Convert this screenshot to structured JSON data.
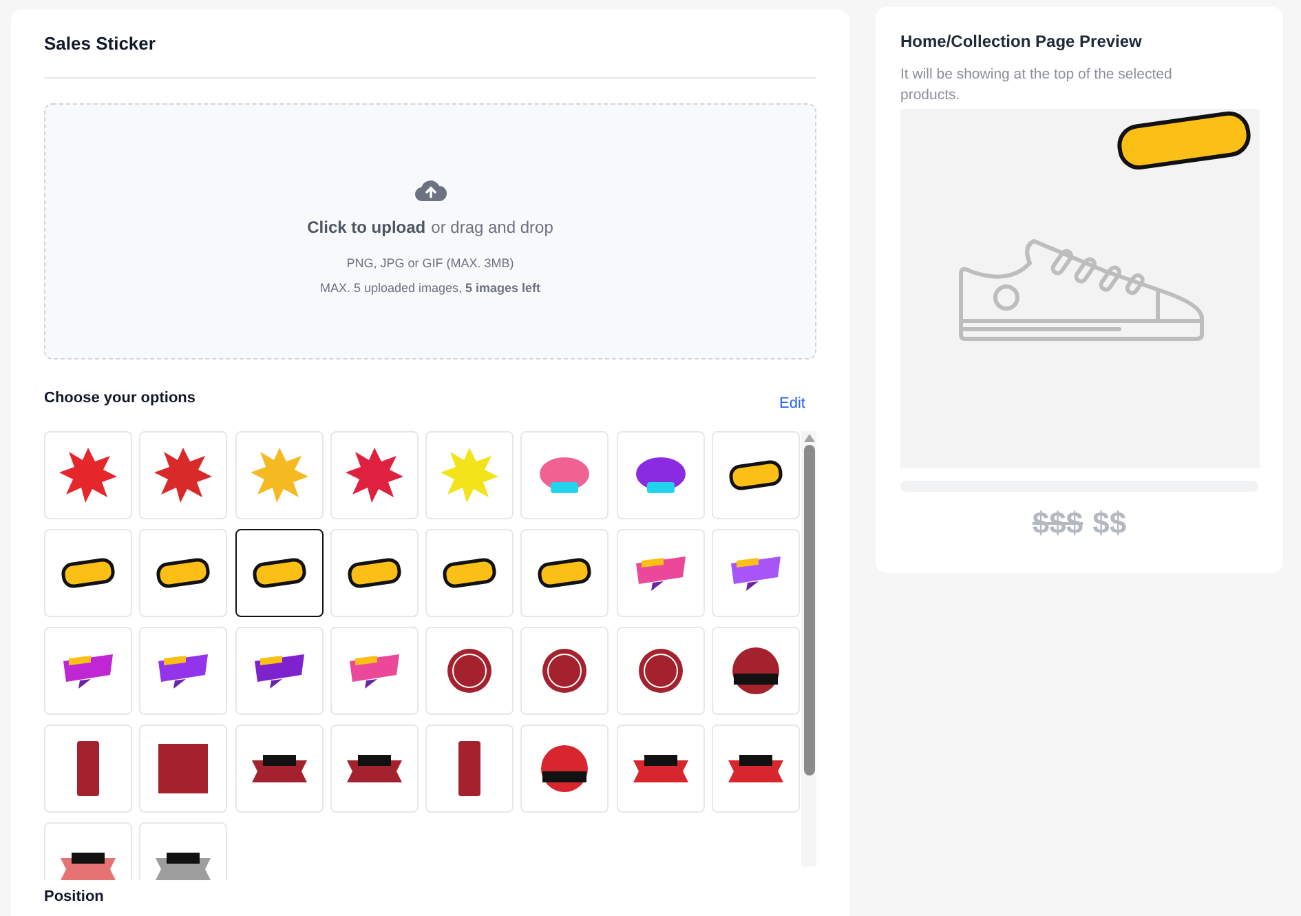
{
  "sticker_panel": {
    "title": "Sales Sticker",
    "upload": {
      "action": "Click to upload",
      "rest": "or drag and drop",
      "formats": "PNG, JPG or GIF (MAX. 3MB)",
      "limit": "MAX. 5 uploaded images, **5 images left**"
    },
    "options_title": "Choose your options",
    "edit_link": "Edit",
    "stickers": [
      {
        "kind": "burst",
        "color": "#e5262b",
        "selected": false
      },
      {
        "kind": "burst",
        "color": "#d92a2a",
        "selected": false
      },
      {
        "kind": "burst",
        "color": "#f5b921",
        "selected": false
      },
      {
        "kind": "burst",
        "color": "#e0203f",
        "selected": false
      },
      {
        "kind": "burst",
        "color": "#f2e31b",
        "selected": false
      },
      {
        "kind": "cloud",
        "color": "#f06292",
        "selected": false
      },
      {
        "kind": "cloud",
        "color": "#8a2be2",
        "selected": false
      },
      {
        "kind": "tag",
        "color": "#fbbf16",
        "selected": false
      },
      {
        "kind": "tag",
        "color": "#fbbf16",
        "selected": false
      },
      {
        "kind": "tag",
        "color": "#fbbf16",
        "selected": false
      },
      {
        "kind": "tag",
        "color": "#fbbf16",
        "selected": true
      },
      {
        "kind": "tag",
        "color": "#fbbf16",
        "selected": false
      },
      {
        "kind": "tag",
        "color": "#fbbf16",
        "selected": false
      },
      {
        "kind": "tag",
        "color": "#fbbf16",
        "selected": false
      },
      {
        "kind": "ribbon",
        "color": "#ec4899",
        "selected": false
      },
      {
        "kind": "ribbon",
        "color": "#a855f7",
        "selected": false
      },
      {
        "kind": "ribbon",
        "color": "#c026d3",
        "selected": false
      },
      {
        "kind": "ribbon",
        "color": "#9333ea",
        "selected": false
      },
      {
        "kind": "ribbon",
        "color": "#7e22ce",
        "selected": false
      },
      {
        "kind": "ribbon",
        "color": "#ec4899",
        "selected": false
      },
      {
        "kind": "seal",
        "color": "#a3222e",
        "selected": false
      },
      {
        "kind": "seal",
        "color": "#a3222e",
        "selected": false
      },
      {
        "kind": "seal",
        "color": "#a3222e",
        "selected": false
      },
      {
        "kind": "circle",
        "color": "#a3222e",
        "selected": false
      },
      {
        "kind": "vertical",
        "color": "#a3222e",
        "selected": false
      },
      {
        "kind": "square",
        "color": "#a3222e",
        "selected": false
      },
      {
        "kind": "banner",
        "color": "#a3222e",
        "selected": false
      },
      {
        "kind": "banner",
        "color": "#a3222e",
        "selected": false
      },
      {
        "kind": "vertical",
        "color": "#a3222e",
        "selected": false
      },
      {
        "kind": "circle",
        "color": "#d7262e",
        "selected": false
      },
      {
        "kind": "banner",
        "color": "#d7262e",
        "selected": false
      },
      {
        "kind": "banner",
        "color": "#d7262e",
        "selected": false
      },
      {
        "kind": "banner",
        "color": "#e57373",
        "selected": false
      },
      {
        "kind": "banner",
        "color": "#9e9e9e",
        "selected": false
      }
    ],
    "next_section": "Position"
  },
  "preview_panel": {
    "title": "Home/Collection Page Preview",
    "subtitle": "It will be showing at the top of the selected products.",
    "old_price": "$$$",
    "price": "$$"
  }
}
